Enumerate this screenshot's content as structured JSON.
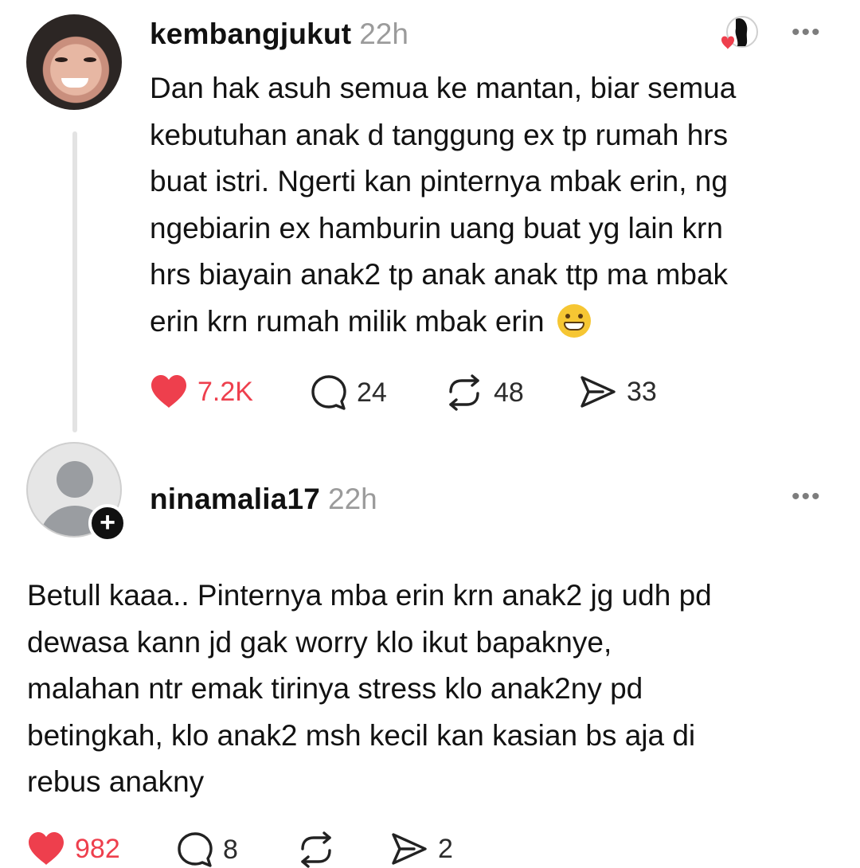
{
  "comments": [
    {
      "username": "kembangjukut",
      "time": "22h",
      "text_lines": [
        "Dan hak asuh semua ke mantan, biar semua",
        "kebutuhan anak d tanggung ex tp rumah hrs",
        "buat istri. Ngerti kan pinternya mbak erin, ng",
        "ngebiarin ex hamburin uang buat yg lain krn",
        "hrs biayain anak2 tp anak anak ttp ma mbak",
        "erin krn rumah milik mbak erin"
      ],
      "emoji": "grinning-face-emoji",
      "more": "•••",
      "actions": {
        "likes": "7.2K",
        "replies": "24",
        "reposts": "48",
        "shares": "33"
      },
      "liked": true
    },
    {
      "username": "ninamalia17",
      "time": "22h",
      "text_lines": [
        "Betull kaaa.. Pinternya mba erin krn anak2 jg udh pd",
        "dewasa kann jd gak worry klo ikut bapaknye,",
        "malahan ntr emak tirinya stress klo anak2ny pd",
        "betingkah, klo anak2 msh kecil kan kasian bs aja di",
        "rebus anakny"
      ],
      "more": "•••",
      "follow_badge": "+",
      "actions": {
        "likes": "982",
        "replies": "8",
        "reposts": "",
        "shares": "2"
      },
      "liked": true
    }
  ],
  "colors": {
    "like": "#ee3f4d",
    "muted": "#9b9b9b",
    "text": "#121212"
  }
}
